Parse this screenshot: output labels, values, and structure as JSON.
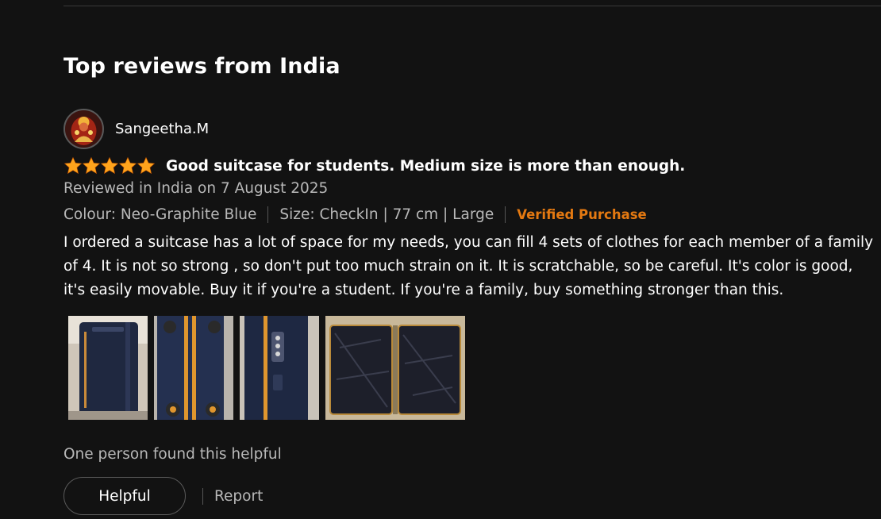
{
  "section": {
    "title": "Top reviews from India"
  },
  "review": {
    "reviewer_name": "Sangeetha.M",
    "rating": 5,
    "rating_max": 5,
    "star_color": "#ffa41c",
    "title": "Good suitcase for students. Medium size is more than enough.",
    "date": "Reviewed in India on 7 August 2025",
    "colour": "Colour: Neo-Graphite Blue",
    "size": "Size: CheckIn | 77 cm | Large",
    "verified": "Verified Purchase",
    "verified_color": "#e47911",
    "body": "I ordered a suitcase has a lot of space for my needs, you can fill 4 sets of clothes for each member of a family of 4. It is not so strong , so don't put too much strain on it. It is scratchable, so be careful. It's color is good, it's easily movable. Buy it if you're a student. If you're a family, buy something stronger than this.",
    "images": [
      "suitcase-side-photo",
      "suitcase-wheels-photo",
      "suitcase-lock-photo",
      "suitcase-open-interior-photo"
    ]
  },
  "footer": {
    "helpful_count": "One person found this helpful",
    "helpful_button": "Helpful",
    "report_link": "Report"
  }
}
